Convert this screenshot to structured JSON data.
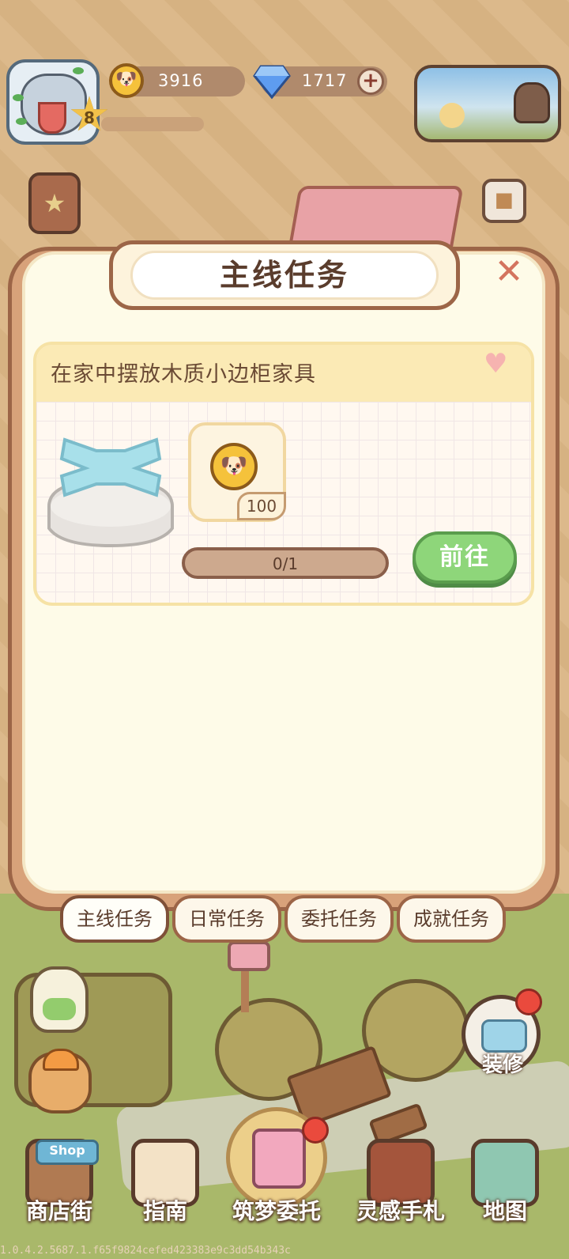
{
  "hud": {
    "level": "8",
    "coins": "3916",
    "gems": "1717",
    "plus": "+"
  },
  "panel": {
    "title": "主线任务",
    "close": "✕"
  },
  "task": {
    "title": "在家中摆放木质小边柜家具",
    "reward_count": "100",
    "progress_text": "0/1",
    "progress_value": 0,
    "go_label": "前往"
  },
  "tabs": [
    {
      "label": "主线任务",
      "active": true
    },
    {
      "label": "日常任务",
      "active": false
    },
    {
      "label": "委托任务",
      "active": false
    },
    {
      "label": "成就任务",
      "active": false
    }
  ],
  "side": {
    "decorate_label": "装修"
  },
  "nav": {
    "shop_sign": "Shop",
    "items": [
      {
        "label": "商店街",
        "icon": "shop-icon"
      },
      {
        "label": "指南",
        "icon": "guide-icon"
      },
      {
        "label": "筑梦委托",
        "icon": "notebook-icon"
      },
      {
        "label": "灵感手札",
        "icon": "journal-icon"
      },
      {
        "label": "地图",
        "icon": "map-icon"
      }
    ]
  },
  "version": "1.0.4.2.5687.1.f65f9824cefed423383e9c3dd54b343c",
  "colors": {
    "panel_border": "#9c6547",
    "go_button": "#8ed67a",
    "title_text": "#5a3c2c",
    "close": "#d4745e"
  }
}
